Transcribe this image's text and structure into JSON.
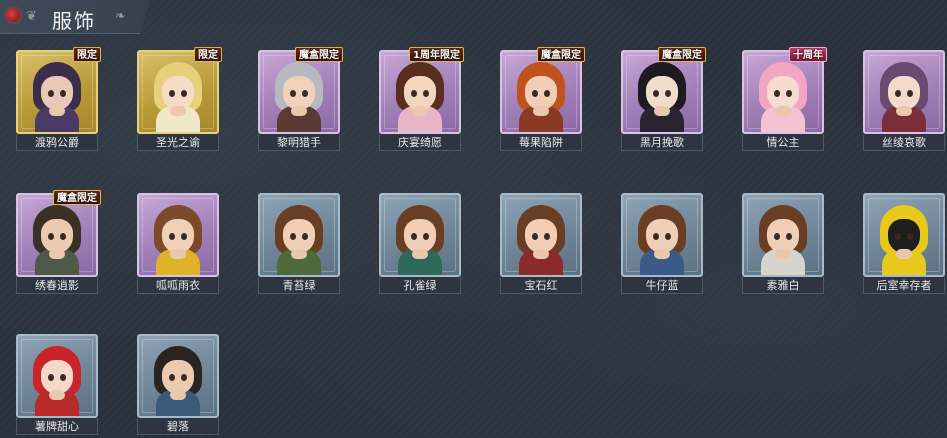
{
  "header": {
    "title": "服饰"
  },
  "costumes": [
    {
      "name": "渡鸦公爵",
      "tag": "限定",
      "tier": "gold",
      "hair": "#3b2e4a",
      "outfit": "#4a3a66",
      "skin": "#e8c9b8"
    },
    {
      "name": "圣光之谕",
      "tag": "限定",
      "tier": "gold",
      "hair": "#e8cf7a",
      "outfit": "#f0e6c8",
      "skin": "#f4dcc6"
    },
    {
      "name": "黎明猎手",
      "tag": "魔盒限定",
      "tier": "purple",
      "hair": "#b8b8c0",
      "outfit": "#5a3a32",
      "skin": "#f0d2bc"
    },
    {
      "name": "庆宴绮愿",
      "tag": "1周年限定",
      "tier": "purple",
      "hair": "#5a2e1e",
      "outfit": "#e8b6c4",
      "skin": "#f3d6c0"
    },
    {
      "name": "莓果陷阱",
      "tag": "魔盒限定",
      "tier": "purple",
      "hair": "#c0521e",
      "outfit": "#8a3a24",
      "skin": "#f0cfb6"
    },
    {
      "name": "黑月挽歌",
      "tag": "魔盒限定",
      "tier": "purple",
      "hair": "#1e1a22",
      "outfit": "#2a2430",
      "skin": "#f2dccc"
    },
    {
      "name": "情公主",
      "tag": "十周年",
      "tier": "purple",
      "hair": "#f2a6c2",
      "outfit": "#f4c2d2",
      "skin": "#f6dcd0"
    },
    {
      "name": "丝绫哀歌",
      "tag": "",
      "tier": "purple",
      "hair": "#6a4a6e",
      "outfit": "#7a2e3a",
      "skin": "#f3dacc"
    },
    {
      "name": "绣春逍影",
      "tag": "魔盒限定",
      "tier": "purple",
      "hair": "#3a3026",
      "outfit": "#4e5a48",
      "skin": "#eccab0"
    },
    {
      "name": "呱呱雨衣",
      "tag": "",
      "tier": "purple",
      "hair": "#7a4a2a",
      "outfit": "#e0b22a",
      "skin": "#f0d0b6"
    },
    {
      "name": "青苔绿",
      "tag": "",
      "tier": "blue",
      "hair": "#6a3e24",
      "outfit": "#4e6a3a",
      "skin": "#f0cfb6"
    },
    {
      "name": "孔雀绿",
      "tag": "",
      "tier": "blue",
      "hair": "#6a3e24",
      "outfit": "#2e6a5a",
      "skin": "#f0cfb6"
    },
    {
      "name": "宝石红",
      "tag": "",
      "tier": "blue",
      "hair": "#6a3e24",
      "outfit": "#8a2a2a",
      "skin": "#f0cfb6"
    },
    {
      "name": "牛仔蓝",
      "tag": "",
      "tier": "blue",
      "hair": "#6a3e24",
      "outfit": "#3a5a8a",
      "skin": "#f0cfb6"
    },
    {
      "name": "素雅白",
      "tag": "",
      "tier": "blue",
      "hair": "#6a3e24",
      "outfit": "#d8d4cc",
      "skin": "#f0cfb6"
    },
    {
      "name": "后室幸存者",
      "tag": "",
      "tier": "blue",
      "hair": "#e8c81a",
      "outfit": "#e8c81a",
      "skin": "#1e1e1e"
    },
    {
      "name": "薯牌甜心",
      "tag": "",
      "tier": "blue",
      "hair": "#c8242a",
      "outfit": "#b82a2a",
      "skin": "#f4d8c8"
    },
    {
      "name": "碧落",
      "tag": "",
      "tier": "blue",
      "hair": "#2a2420",
      "outfit": "#3a5a7a",
      "skin": "#eccab0"
    }
  ]
}
